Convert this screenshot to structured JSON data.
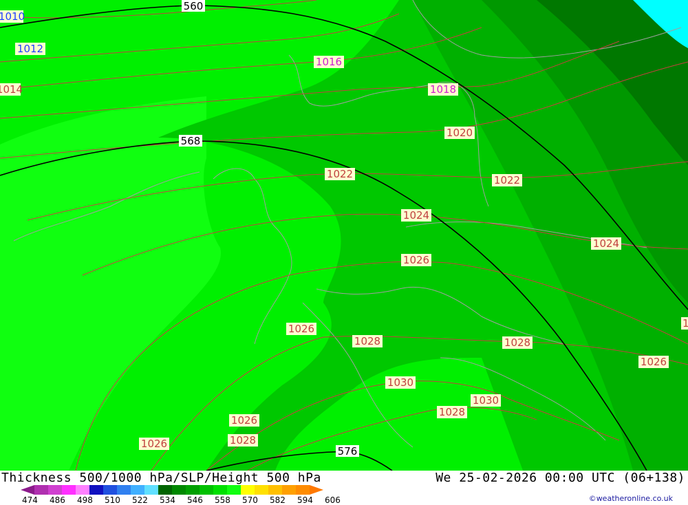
{
  "title": "Thickness 500/1000 hPa/SLP/Height 500 hPa",
  "valid_time": "We 25-02-2026 00:00 UTC (06+138)",
  "credit": "©weatheronline.co.uk",
  "colorbar": {
    "ticks": [
      "474",
      "486",
      "498",
      "510",
      "522",
      "534",
      "546",
      "558",
      "570",
      "582",
      "594",
      "606"
    ],
    "colors": [
      "#8b1a8b",
      "#b030b0",
      "#d040d0",
      "#ff30ff",
      "#ff80ff",
      "#1010c0",
      "#2050e0",
      "#3080f0",
      "#40b0ff",
      "#60e0ff",
      "#006400",
      "#008800",
      "#00a000",
      "#00c000",
      "#00e000",
      "#10ff10",
      "#ffff00",
      "#ffe000",
      "#ffc000",
      "#ffa000",
      "#ff8c00",
      "#ff7800"
    ]
  },
  "slp_labels": [
    "1010",
    "1012",
    "1014",
    "1016",
    "1018",
    "1020",
    "1022",
    "1022",
    "1024",
    "1024",
    "1026",
    "1026",
    "1028",
    "1028",
    "1026",
    "1030",
    "1030",
    "1028",
    "1026",
    "1028",
    "1026",
    "1"
  ],
  "height_labels": [
    "560",
    "568",
    "576"
  ],
  "colors": {
    "slp_isobar": "#c84040",
    "height_contour": "#000000",
    "border": "#a0a0a0",
    "sea": "#00ffff"
  }
}
